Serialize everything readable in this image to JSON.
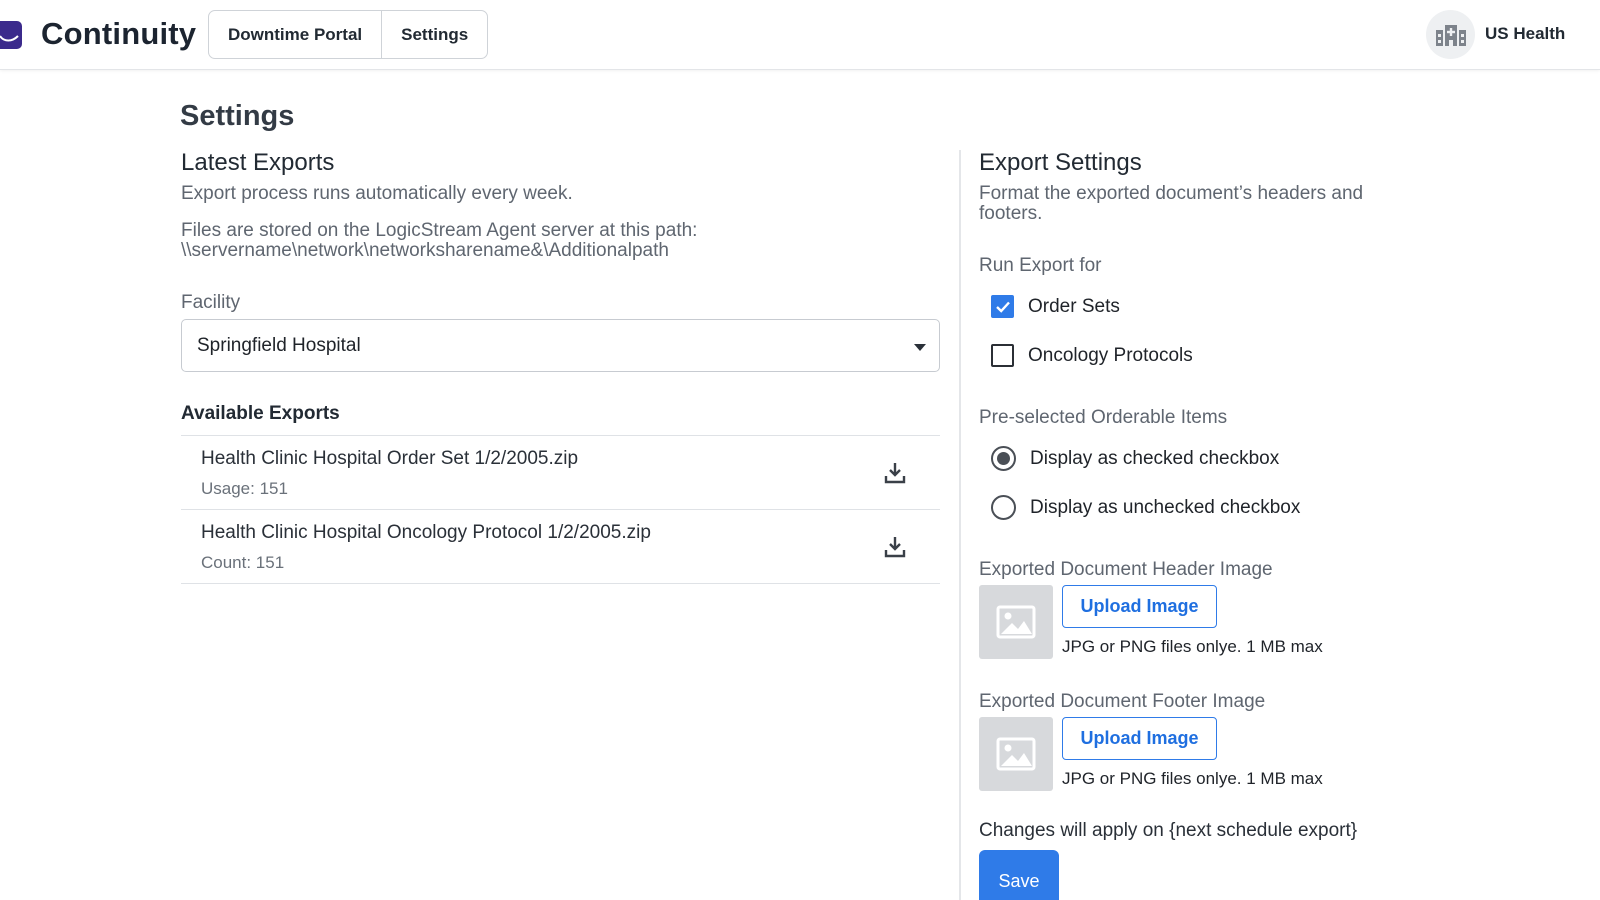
{
  "header": {
    "brand": "Continuity",
    "nav": [
      "Downtime Portal",
      "Settings"
    ],
    "org_name": "US Health",
    "logo_icon": "continuity-logo-icon",
    "org_icon": "hospital-building-icon"
  },
  "page_title": "Settings",
  "latest_exports": {
    "title": "Latest Exports",
    "schedule_text": "Export process runs automatically every week.",
    "path_intro": "Files are stored on the LogicStream Agent server at this path:",
    "path": "\\\\servername\\network\\networksharename&\\Additionalpath",
    "facility_label": "Facility",
    "facility_value": "Springfield Hospital",
    "available_title": "Available Exports",
    "items": [
      {
        "name": "Health Clinic Hospital Order Set 1/2/2005.zip",
        "meta": "Usage: 151"
      },
      {
        "name": "Health Clinic Hospital Oncology Protocol 1/2/2005.zip",
        "meta": "Count: 151"
      }
    ]
  },
  "export_settings": {
    "title": "Export Settings",
    "description": "Format the exported document’s headers and footers.",
    "run_export_label": "Run Export for",
    "run_export_options": [
      {
        "label": "Order Sets",
        "checked": true
      },
      {
        "label": "Oncology Protocols",
        "checked": false
      }
    ],
    "preselected_label": "Pre-selected Orderable Items",
    "preselected_options": [
      {
        "label": "Display as checked checkbox",
        "selected": true
      },
      {
        "label": "Display as unchecked checkbox",
        "selected": false
      }
    ],
    "header_image_label": "Exported Document Header Image",
    "footer_image_label": "Exported Document Footer Image",
    "upload_label": "Upload Image",
    "upload_hint": "JPG or PNG files onlye. 1 MB max",
    "changes_note": "Changes will apply on {next schedule export}",
    "save_label": "Save"
  },
  "colors": {
    "accent": "#2f7be8",
    "brand_purple": "#3b2a8c",
    "muted_text": "#5f6670"
  }
}
